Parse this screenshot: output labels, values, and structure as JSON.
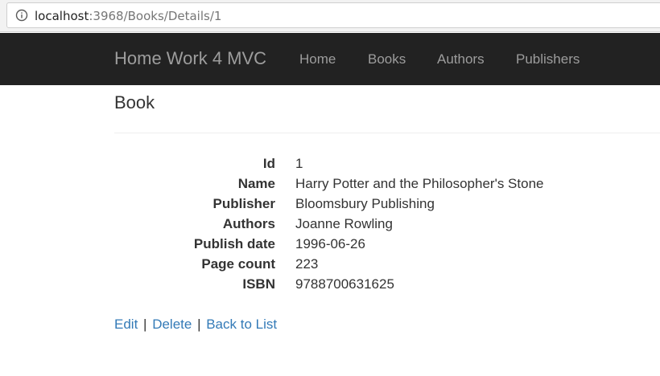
{
  "browser": {
    "url_host": "localhost",
    "url_rest": ":3968/Books/Details/1"
  },
  "navbar": {
    "brand": "Home Work 4 MVC",
    "links": [
      "Home",
      "Books",
      "Authors",
      "Publishers"
    ]
  },
  "page": {
    "title": "Book"
  },
  "details": [
    {
      "label": "Id",
      "value": "1"
    },
    {
      "label": "Name",
      "value": "Harry Potter and the Philosopher's Stone"
    },
    {
      "label": "Publisher",
      "value": "Bloomsbury Publishing"
    },
    {
      "label": "Authors",
      "value": "Joanne Rowling"
    },
    {
      "label": "Publish date",
      "value": "1996-06-26"
    },
    {
      "label": "Page count",
      "value": "223"
    },
    {
      "label": "ISBN",
      "value": "9788700631625"
    }
  ],
  "actions": {
    "edit": "Edit",
    "delete": "Delete",
    "back": "Back to List",
    "separator": "|"
  },
  "colors": {
    "navbar_bg": "#222222",
    "nav_text": "#9d9d9d",
    "link": "#337ab7"
  },
  "icons": {
    "address_bar": "info-circle-icon"
  }
}
